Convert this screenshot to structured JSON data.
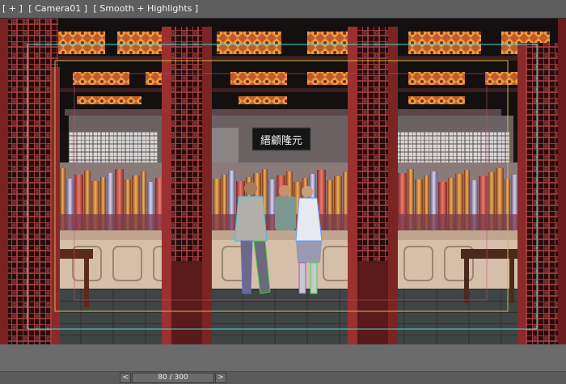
{
  "viewport": {
    "plus_label": "[ + ]",
    "camera_label": "[ Camera01 ]",
    "shading_label": "[ Smooth + Highlights ]",
    "sign_text": "縉顧隆元"
  },
  "timeline": {
    "prev_label": "<",
    "next_label": ">",
    "frame_text": "80 / 300",
    "current_frame": 80,
    "total_frames": 300
  },
  "colors": {
    "viewport_bg": "#000000",
    "ui_gray": "#6f6f6f",
    "safe_frame_cyan": "#4fd6d6",
    "safe_frame_yellow": "#d4b44a",
    "door_red": "#8a2a2a",
    "counter_wood": "#d6bfa8"
  }
}
